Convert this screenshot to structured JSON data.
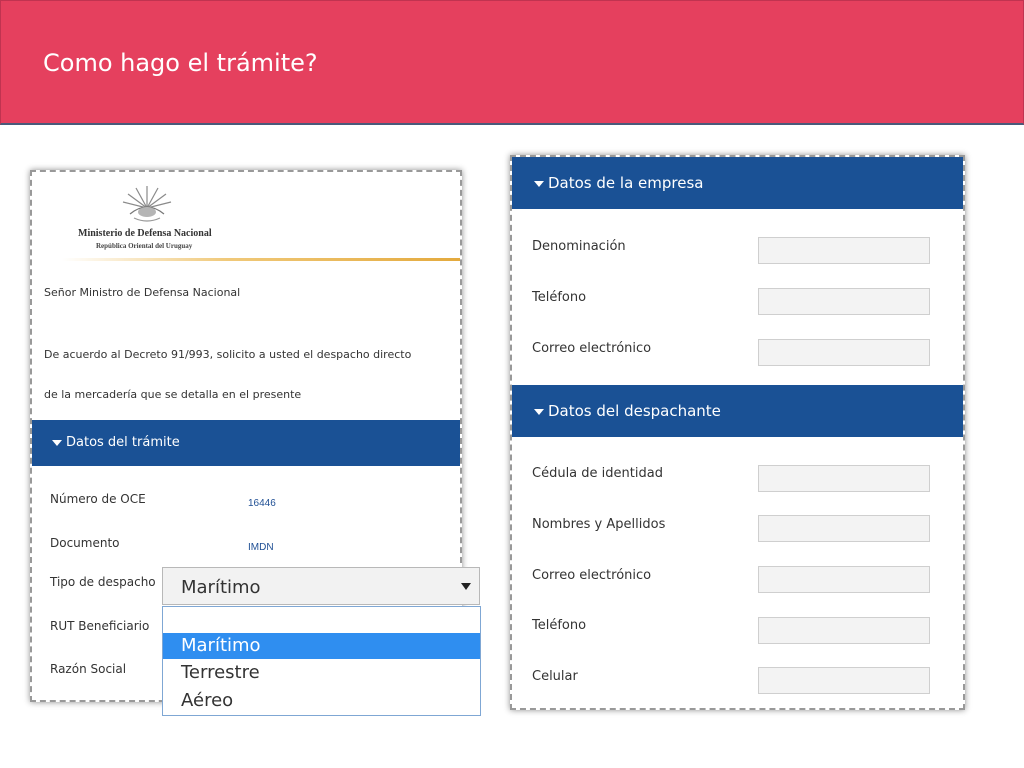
{
  "header": {
    "title": "Como hago el trámite?"
  },
  "left": {
    "logo": {
      "ministry": "Ministerio de Defensa Nacional",
      "country": "República Oriental del Uruguay"
    },
    "greeting": "Señor Ministro de Defensa Nacional",
    "body_line1": "De acuerdo al Decreto 91/993, solicito a usted el despacho directo",
    "body_line2": "de la mercadería que se detalla en el presente",
    "section_title": "Datos del trámite",
    "fields": {
      "oce_label": "Número de OCE",
      "oce_value": "16446",
      "documento_label": "Documento",
      "documento_value": "IMDN",
      "tipo_label": "Tipo de despacho",
      "rut_label": "RUT Beneficiario",
      "razon_label": "Razón Social"
    },
    "select": {
      "value": "Marítimo",
      "options": [
        "Marítimo",
        "Terrestre",
        "Aéreo"
      ],
      "selected_index": 0
    }
  },
  "right": {
    "empresa_title": "Datos de la empresa",
    "empresa_fields": [
      "Denominación",
      "Teléfono",
      "Correo electrónico"
    ],
    "despachante_title": "Datos del despachante",
    "despachante_fields": [
      "Cédula de identidad",
      "Nombres y Apellidos",
      "Correo electrónico",
      "Teléfono",
      "Celular"
    ]
  },
  "colors": {
    "header": "#e5405e",
    "section": "#1a5195",
    "selected_option": "#2f8ef0",
    "value_text": "#1f4f94"
  }
}
